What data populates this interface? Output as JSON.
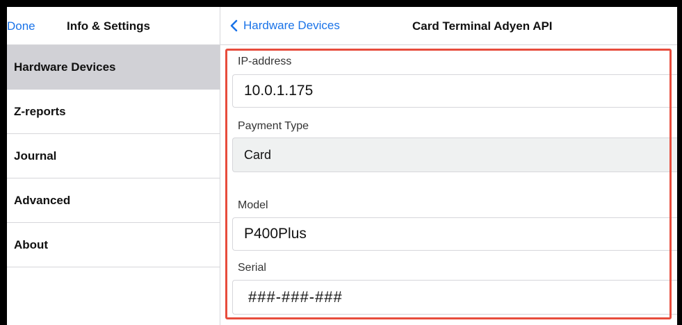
{
  "left_header": {
    "done": "Done",
    "title": "Info & Settings"
  },
  "menu": [
    {
      "label": "Hardware Devices",
      "selected": true
    },
    {
      "label": "Z-reports"
    },
    {
      "label": "Journal"
    },
    {
      "label": "Advanced"
    },
    {
      "label": "About"
    }
  ],
  "right_header": {
    "back": "Hardware Devices",
    "title": "Card Terminal Adyen API"
  },
  "form": {
    "ip": {
      "label": "IP-address",
      "value": "10.0.1.175"
    },
    "payment": {
      "label": "Payment Type",
      "value": "Card"
    },
    "model": {
      "label": "Model",
      "value": "P400Plus"
    },
    "serial": {
      "label": "Serial",
      "value": "###-###-###"
    }
  },
  "colors": {
    "accent": "#1a73e8",
    "highlight": "#e74c3c",
    "selected_row": "#d1d1d6"
  }
}
